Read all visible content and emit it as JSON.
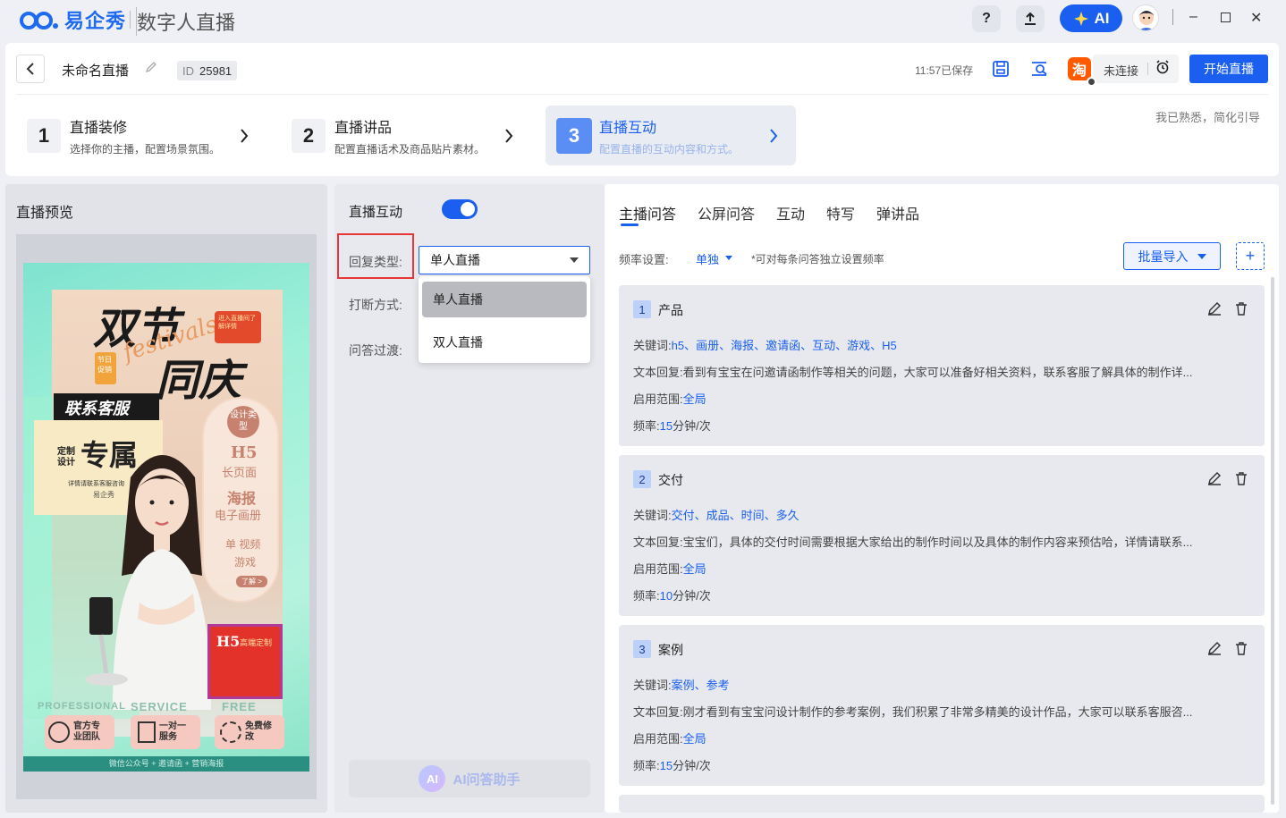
{
  "app": {
    "brand": "易企秀",
    "title": "数字人直播",
    "ai_label": "AI"
  },
  "titlebar": {
    "help": "?",
    "upload": "⇧",
    "minimize": "–",
    "maximize": "□",
    "close": "✕"
  },
  "header": {
    "doc_title": "未命名直播",
    "id_label": "ID",
    "id_value": "25981",
    "saved_text": "11:57已保存",
    "platform": "淘",
    "connection": "未连接",
    "start_button": "开始直播",
    "guide_link": "我已熟悉，简化引导"
  },
  "steps": [
    {
      "num": "1",
      "title": "直播装修",
      "desc": "选择你的主播，配置场景氛围。"
    },
    {
      "num": "2",
      "title": "直播讲品",
      "desc": "配置直播话术及商品贴片素材。"
    },
    {
      "num": "3",
      "title": "直播互动",
      "desc": "配置直播的互动内容和方式。"
    }
  ],
  "preview": {
    "title": "直播预览",
    "poster": {
      "t1": "双节",
      "t2": "同庆",
      "script": "festivals",
      "badge": "进入直播间了解详情",
      "tag": "节日促销",
      "contact": "联系客服",
      "exclusive": "专属",
      "custom": "定制设计",
      "consult": "详情请联系客服咨询",
      "brand": "易企秀",
      "c1": "设计类型",
      "c2": "H5",
      "c2b": "长页面",
      "c3": "海报",
      "c3b": "电子画册",
      "c4": "单 视频",
      "c4b": "游戏",
      "more": "了解 >",
      "h5": "H5",
      "h5b": "高端定制",
      "eng": [
        "PROFESSIONAL",
        "SERVICE",
        "FREE"
      ],
      "f1": "官方专业团队",
      "f2": "一对一服务",
      "f3": "免费修改",
      "bottom": "微信公众号 + 邀请函 + 营销海报"
    }
  },
  "interaction": {
    "title": "直播互动",
    "toggle_on": true,
    "reply_type_label": "回复类型:",
    "reply_type_value": "单人直播",
    "interrupt_label": "打断方式:",
    "transition_label": "问答过渡:",
    "options": [
      "单人直播",
      "双人直播"
    ],
    "ai_assist": "AI问答助手",
    "ai_icon": "AI"
  },
  "qa": {
    "tabs": [
      "主播问答",
      "公屏问答",
      "互动",
      "特写",
      "弹讲品"
    ],
    "freq_label": "频率设置:",
    "freq_value": "单独",
    "freq_note": "*可对每条问答独立设置频率",
    "import_button": "批量导入",
    "add": "+",
    "keywords_label": "关键词:",
    "reply_label": "文本回复:",
    "scope_label": "启用范围:",
    "rate_label": "频率:",
    "items": [
      {
        "num": "1",
        "name": "产品",
        "keywords": "h5、画册、海报、邀请函、互动、游戏、H5",
        "reply": "看到有宝宝在问邀请函制作等相关的问题，大家可以准备好相关资料，联系客服了解具体的制作详...",
        "scope": "全局",
        "rate_num": "15",
        "rate_unit": "分钟/次"
      },
      {
        "num": "2",
        "name": "交付",
        "keywords": "交付、成品、时间、多久",
        "reply": "宝宝们，具体的交付时间需要根据大家给出的制作时间以及具体的制作内容来预估哈，详情请联系...",
        "scope": "全局",
        "rate_num": "10",
        "rate_unit": "分钟/次"
      },
      {
        "num": "3",
        "name": "案例",
        "keywords": "案例、参考",
        "reply": "刚才看到有宝宝问设计制作的参考案例，我们积累了非常多精美的设计作品，大家可以联系客服咨...",
        "scope": "全局",
        "rate_num": "15",
        "rate_unit": "分钟/次"
      }
    ]
  },
  "colors": {
    "accent": "#1a5ff0",
    "highlight": "#e83535",
    "taobao": "#ff5a00"
  }
}
